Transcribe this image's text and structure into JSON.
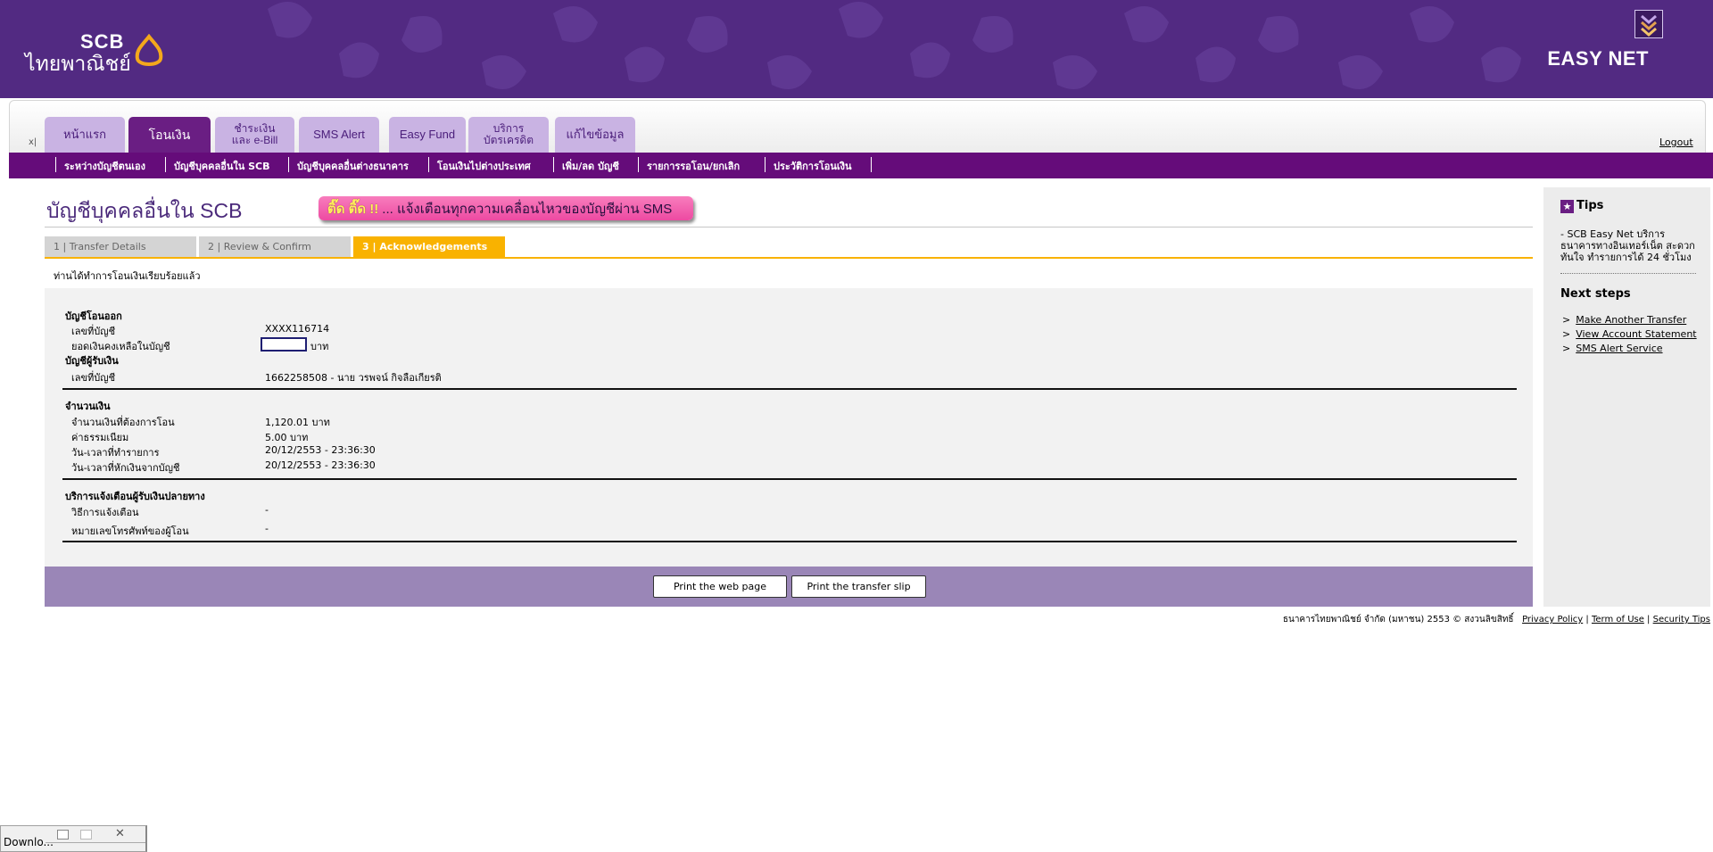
{
  "header": {
    "logo_scb": "SCB",
    "logo_thai": "ไทยพาณิชย์",
    "brand": "EASY NET"
  },
  "nav": {
    "tabs": [
      "หน้าแรก",
      "โอนเงิน",
      "ชำระเงิน|และ e-Bill",
      "SMS Alert",
      "Easy Fund",
      "บริการ|บัตรเครดิต",
      "แก้ไขข้อมูล"
    ],
    "active_tab": "โอนเงิน",
    "logout": "Logout",
    "x_mark": "x|"
  },
  "subnav": [
    "ระหว่างบัญชีตนเอง",
    "บัญชีบุคคลอื่นใน SCB",
    "บัญชีบุคคลอื่นต่างธนาคาร",
    "โอนเงินไปต่างประเทศ",
    "เพิ่ม/ลด บัญชี",
    "รายการรอโอน/ยกเลิก",
    "ประวัติการโอนเงิน"
  ],
  "page": {
    "title": "บัญชีบุคคลอื่นใน SCB",
    "promo_highlight": "ติ๊ด ติ๊ด !!",
    "promo_text": "... แจ้งเตือนทุกความเคลื่อนไหวของบัญชีผ่าน SMS",
    "steps": [
      "1 | Transfer Details",
      "2 | Review & Confirm",
      "3 | Acknowledgements"
    ],
    "current_step": 3,
    "done_message": "ท่านได้ทำการโอนเงินเรียบร้อยแล้ว"
  },
  "details": {
    "from_title": "บัญชีโอนออก",
    "from_account_label": "เลขที่บัญชี",
    "from_account_value": "XXXX116714",
    "balance_label": "ยอดเงินคงเหลือในบัญชี",
    "balance_unit": "บาท",
    "to_title": "บัญชีผู้รับเงิน",
    "to_account_label": "เลขที่บัญชี",
    "to_account_value": "1662258508 - นาย วรพจน์ กิจลือเกียรติ",
    "amount_title": "จำนวนเงิน",
    "amount_label": "จำนวนเงินที่ต้องการโอน",
    "amount_value": "1,120.01 บาท",
    "fee_label": "ค่าธรรมเนียม",
    "fee_value": "5.00 บาท",
    "txn_time_label": "วัน-เวลาที่ทำรายการ",
    "txn_time_value": "20/12/2553 - 23:36:30",
    "debit_time_label": "วัน-เวลาที่หักเงินจากบัญชี",
    "debit_time_value": "20/12/2553 - 23:36:30",
    "notify_title": "บริการแจ้งเตือนผู้รับเงินปลายทาง",
    "notify_method_label": "วิธีการแจ้งเตือน",
    "notify_method_value": "-",
    "notify_phone_label": "หมายเลขโทรศัพท์ของผู้โอน",
    "notify_phone_value": "-"
  },
  "buttons": {
    "print_page": "Print the web page",
    "print_slip": "Print the transfer slip"
  },
  "sidebar": {
    "tips_title": "Tips",
    "tips_text": "- SCB Easy Net บริการธนาคารทางอินเทอร์เน็ต สะดวก ทันใจ ทำรายการได้ 24 ชั่วโมง",
    "next_title": "Next steps",
    "links": [
      "Make Another Transfer",
      "View Account Statement",
      "SMS Alert Service"
    ]
  },
  "footer": {
    "copyright": "ธนาคารไทยพาณิชย์ จำกัด (มหาชน) 2553 © สงวนลิขสิทธิ์",
    "links": [
      "Privacy Policy",
      "Term of Use",
      "Security Tips"
    ]
  },
  "download_bar": {
    "label": "Downlo..."
  },
  "colors": {
    "brand_purple": "#522a82",
    "active_tab": "#6a1e83",
    "subnav": "#650c7a",
    "step_active": "#f9b200",
    "promo_pink": "#f06aae"
  }
}
